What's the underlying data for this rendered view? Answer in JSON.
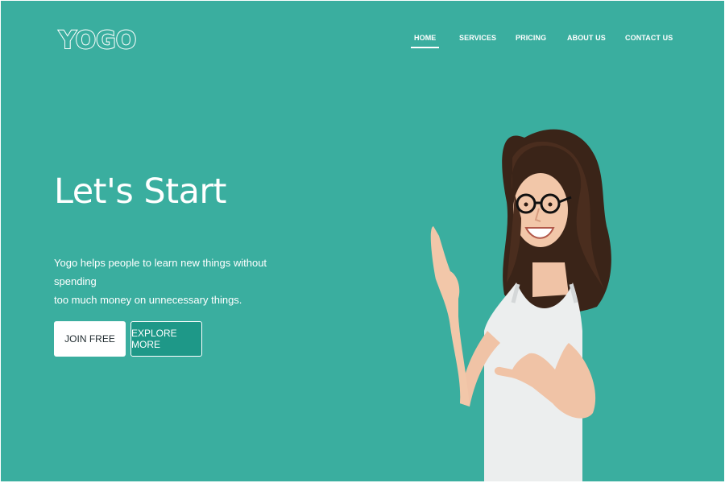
{
  "brand": {
    "logo_text": "YOGO"
  },
  "nav": {
    "items": [
      {
        "label": "HOME",
        "active": true
      },
      {
        "label": "SERVICES",
        "active": false
      },
      {
        "label": "PRICING",
        "active": false
      },
      {
        "label": "ABOUT US",
        "active": false
      },
      {
        "label": "CONTACT US",
        "active": false
      }
    ]
  },
  "hero": {
    "title": "Let's Start",
    "description_line1": "Yogo helps people to learn new things without spending",
    "description_line2": "too much money on unnecessary things.",
    "join_label": "JOIN FREE",
    "explore_label": "EXPLORE MORE"
  },
  "colors": {
    "background": "#3aae9f",
    "explore_button": "#1e9888",
    "text": "#ffffff"
  },
  "icons": [
    "woman-pointing-photo"
  ]
}
